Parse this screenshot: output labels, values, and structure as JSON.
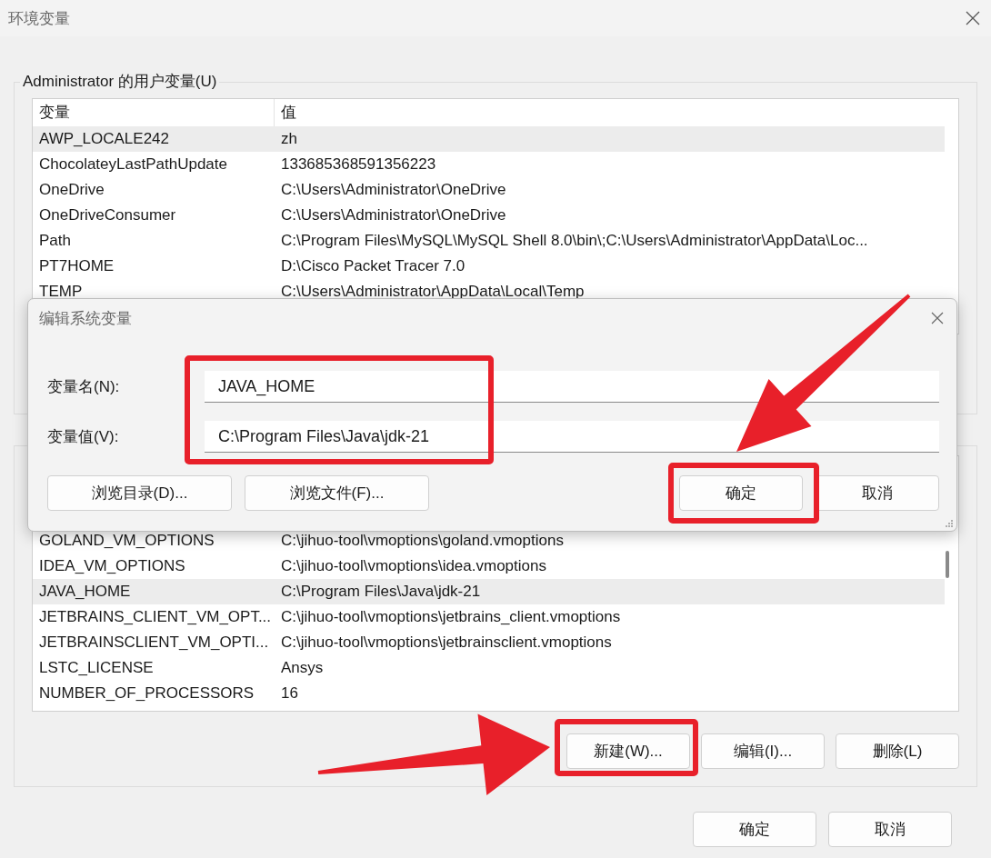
{
  "window": {
    "title": "环境变量"
  },
  "user_vars": {
    "title": "Administrator 的用户变量(U)",
    "columns": [
      "变量",
      "值"
    ],
    "rows": [
      {
        "name": "AWP_LOCALE242",
        "value": "zh",
        "selected": true
      },
      {
        "name": "ChocolateyLastPathUpdate",
        "value": "133685368591356223",
        "selected": false
      },
      {
        "name": "OneDrive",
        "value": "C:\\Users\\Administrator\\OneDrive",
        "selected": false
      },
      {
        "name": "OneDriveConsumer",
        "value": "C:\\Users\\Administrator\\OneDrive",
        "selected": false
      },
      {
        "name": "Path",
        "value": "C:\\Program Files\\MySQL\\MySQL Shell 8.0\\bin\\;C:\\Users\\Administrator\\AppData\\Loc...",
        "selected": false
      },
      {
        "name": "PT7HOME",
        "value": "D:\\Cisco Packet Tracer 7.0",
        "selected": false
      },
      {
        "name": "TEMP",
        "value": "C:\\Users\\Administrator\\AppData\\Local\\Temp",
        "selected": false
      }
    ]
  },
  "edit_dialog": {
    "title": "编辑系统变量",
    "fields": [
      {
        "label": "变量名(N):",
        "value": "JAVA_HOME"
      },
      {
        "label": "变量值(V):",
        "value": "C:\\Program Files\\Java\\jdk-21"
      }
    ],
    "left_buttons": [
      "浏览目录(D)...",
      "浏览文件(F)..."
    ],
    "right_buttons": [
      "确定",
      "取消"
    ]
  },
  "system_vars": {
    "rows": [
      {
        "name": "GOLAND_VM_OPTIONS",
        "value": "C:\\jihuo-tool\\vmoptions\\goland.vmoptions",
        "selected": false
      },
      {
        "name": "IDEA_VM_OPTIONS",
        "value": "C:\\jihuo-tool\\vmoptions\\idea.vmoptions",
        "selected": false
      },
      {
        "name": "JAVA_HOME",
        "value": "C:\\Program Files\\Java\\jdk-21",
        "selected": true
      },
      {
        "name": "JETBRAINS_CLIENT_VM_OPT...",
        "value": "C:\\jihuo-tool\\vmoptions\\jetbrains_client.vmoptions",
        "selected": false
      },
      {
        "name": "JETBRAINSCLIENT_VM_OPTI...",
        "value": "C:\\jihuo-tool\\vmoptions\\jetbrainsclient.vmoptions",
        "selected": false
      },
      {
        "name": "LSTC_LICENSE",
        "value": "Ansys",
        "selected": false
      },
      {
        "name": "NUMBER_OF_PROCESSORS",
        "value": "16",
        "selected": false
      }
    ],
    "buttons": [
      "新建(W)...",
      "编辑(I)...",
      "删除(L)"
    ]
  },
  "buttons": [
    "确定",
    "取消"
  ]
}
